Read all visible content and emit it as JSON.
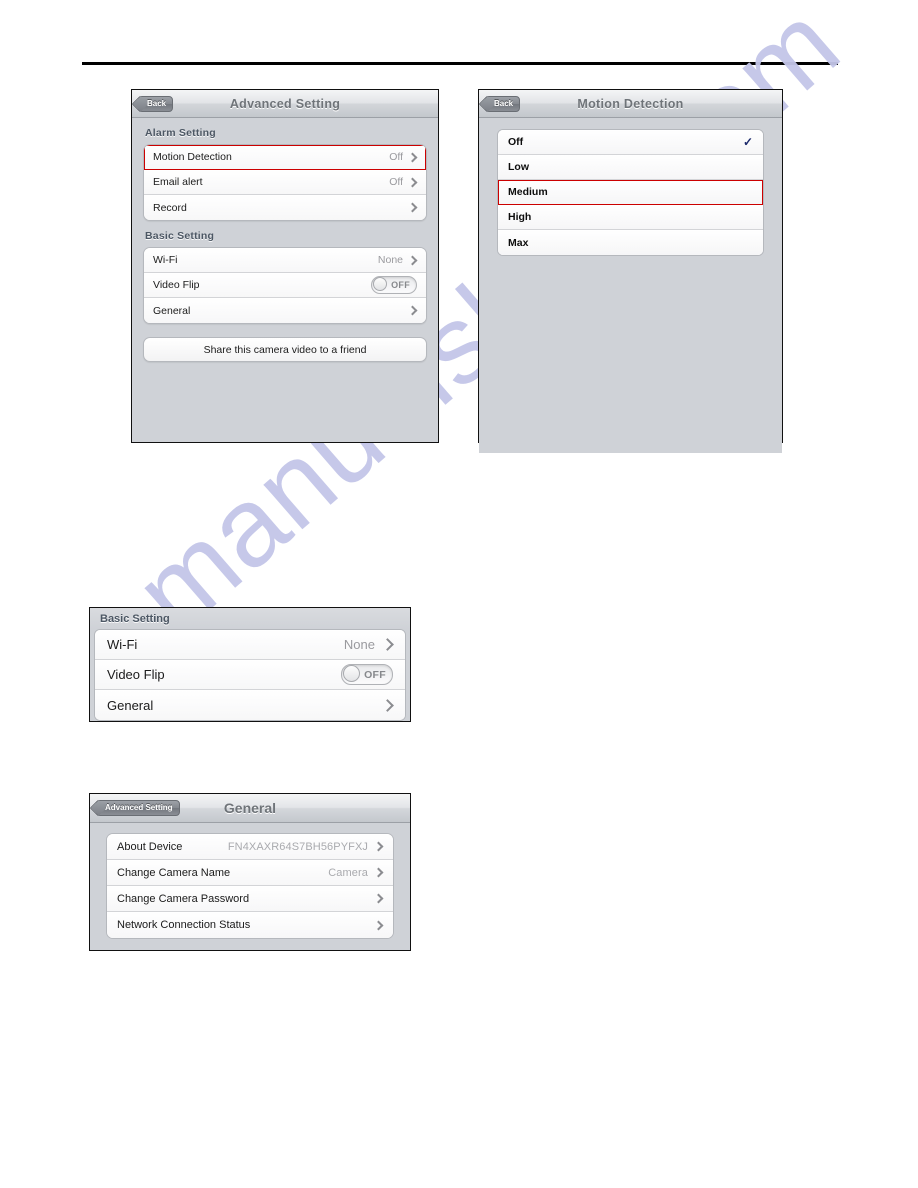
{
  "watermark": {
    "text": "manualshive.com",
    "color": "#c3c6e8"
  },
  "divider": {
    "present": true
  },
  "panels": {
    "advanced_setting": {
      "navbar": {
        "back_label": "Back",
        "title": "Advanced Setting"
      },
      "sections": [
        {
          "header": "Alarm Setting",
          "rows": [
            {
              "label": "Motion Detection",
              "value": "Off",
              "accessory": "chevron",
              "highlighted": true
            },
            {
              "label": "Email alert",
              "value": "Off",
              "accessory": "chevron",
              "highlighted": false
            },
            {
              "label": "Record",
              "value": "",
              "accessory": "chevron",
              "highlighted": false
            }
          ]
        },
        {
          "header": "Basic Setting",
          "rows": [
            {
              "label": "Wi-Fi",
              "value": "None",
              "accessory": "chevron",
              "highlighted": false
            },
            {
              "label": "Video Flip",
              "value": "",
              "accessory": "toggle",
              "toggle_state": "OFF",
              "highlighted": false
            },
            {
              "label": "General",
              "value": "",
              "accessory": "chevron",
              "highlighted": false
            }
          ]
        }
      ],
      "share_button": "Share this camera video to a friend",
      "highlight_color": "#cc0000"
    },
    "motion_detection": {
      "navbar": {
        "back_label": "Back",
        "title": "Motion Detection"
      },
      "options": [
        {
          "label": "Off",
          "checked": true,
          "highlighted": false
        },
        {
          "label": "Low",
          "checked": false,
          "highlighted": false
        },
        {
          "label": "Medium",
          "checked": false,
          "highlighted": true
        },
        {
          "label": "High",
          "checked": false,
          "highlighted": false
        },
        {
          "label": "Max",
          "checked": false,
          "highlighted": false
        }
      ],
      "check_glyph": "✓",
      "check_color": "#1c2a6b",
      "highlight_color": "#cc0000"
    },
    "basic_setting_crop": {
      "header": "Basic Setting",
      "rows": [
        {
          "label": "Wi-Fi",
          "value": "None",
          "accessory": "chevron"
        },
        {
          "label": "Video Flip",
          "value": "",
          "accessory": "toggle",
          "toggle_state": "OFF"
        },
        {
          "label": "General",
          "value": "",
          "accessory": "chevron"
        }
      ]
    },
    "general": {
      "navbar": {
        "back_label": "Advanced Setting",
        "title": "General"
      },
      "rows": [
        {
          "label": "About Device",
          "value": "FN4XAXR64S7BH56PYFXJ",
          "accessory": "chevron"
        },
        {
          "label": "Change Camera Name",
          "value": "Camera",
          "accessory": "chevron"
        },
        {
          "label": "Change Camera Password",
          "value": "",
          "accessory": "chevron"
        },
        {
          "label": "Network Connection Status",
          "value": "",
          "accessory": "chevron"
        }
      ]
    }
  }
}
